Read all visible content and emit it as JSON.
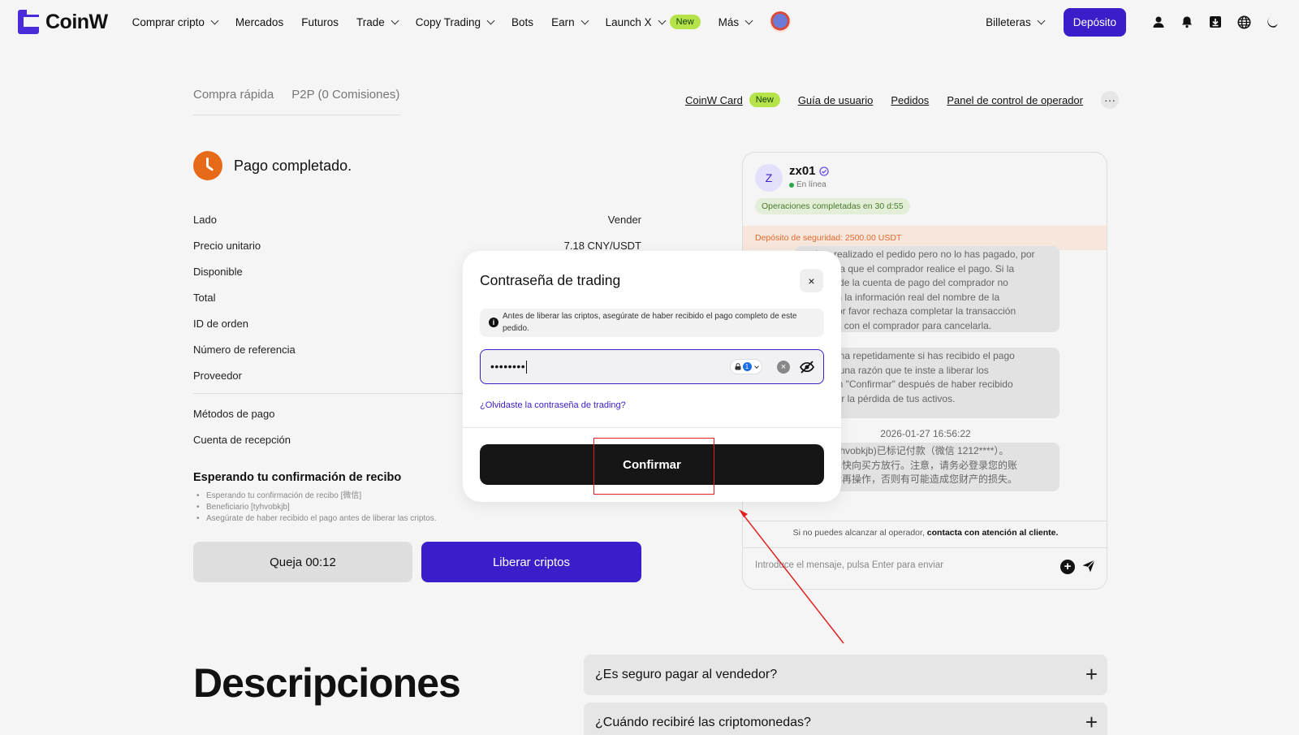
{
  "header": {
    "logo_text": "CoinW",
    "nav": [
      {
        "label": "Comprar cripto",
        "chevron": true
      },
      {
        "label": "Mercados",
        "chevron": false
      },
      {
        "label": "Futuros",
        "chevron": false
      },
      {
        "label": "Trade",
        "chevron": true
      },
      {
        "label": "Copy Trading",
        "chevron": true
      },
      {
        "label": "Bots",
        "chevron": false
      },
      {
        "label": "Earn",
        "chevron": true
      },
      {
        "label": "Launch X",
        "chevron": true,
        "badge": "New"
      },
      {
        "label": "Más",
        "chevron": true
      }
    ],
    "wallets_label": "Billeteras",
    "deposit_label": "Depósito",
    "icons": [
      "user-icon",
      "bell-icon",
      "download-icon",
      "globe-icon",
      "moon-icon"
    ],
    "accent": "#3b1dc9"
  },
  "tabs": {
    "quick_buy": "Compra rápida",
    "p2p": "P2P (0 Comisiones)"
  },
  "toplinks": {
    "card": "CoinW Card",
    "card_badge": "New",
    "guide": "Guía de usuario",
    "orders": "Pedidos",
    "operator_panel": "Panel de control de operador",
    "more": "···"
  },
  "order": {
    "status_title": "Pago completado.",
    "rows": [
      {
        "label": "Lado",
        "value": "Vender"
      },
      {
        "label": "Precio unitario",
        "value": "7.18 CNY/USDT"
      },
      {
        "label": "Disponible",
        "value": ""
      },
      {
        "label": "Total",
        "value": ""
      },
      {
        "label": "ID de orden",
        "value": ""
      },
      {
        "label": "Número de referencia",
        "value": ""
      },
      {
        "label": "Proveedor",
        "value": ""
      },
      {
        "label": "Métodos de pago",
        "value": ""
      },
      {
        "label": "Cuenta de recepción",
        "value": ""
      }
    ],
    "waiting_title": "Esperando tu confirmación de recibo",
    "bullets": [
      "Esperando tu confirmación de recibo [微信]",
      "Beneficiario [tyhvobkjb]",
      "Asegúrate de haber recibido el pago antes de liberar las criptos."
    ],
    "complaint_label": "Queja 00:12",
    "release_label": "Liberar criptos"
  },
  "chat": {
    "avatar_letter": "Z",
    "name": "zx01",
    "status": "En línea",
    "ops": "Operaciones completadas en 30 d:55",
    "deposit": "Depósito de seguridad: 2500.00 USDT",
    "messages": [
      "… has realizado el pedido pero no lo has pagado, por\n…spera a que el comprador realice el pago. Si la\n…ación de la cuenta de pago del comprador no\n…de con la información real del nombre de la\n…ma, por favor rechaza completar la transacción\n…egocia con el comprador para cancelarla.",
      "…confirma repetidamente si has recibido el pago\n…n ninguna razón que te inste a liberar los\n… clic en \"Confirmar\" después de haber recibido\n…a evitar la pérdida de tus activos.",
      "…名：tyhvobkjb)已标记付款（微信 1212****）。\n…收并尽快向买方放行。注意，请务必登录您的账\n…收款后再操作，否则有可能造成您财产的损失。"
    ],
    "timestamp": "2026-01-27 16:56:22",
    "help_prefix": "Si no puedes alcanzar al operador, ",
    "help_link": "contacta con atención al cliente.",
    "input_placeholder": "Introduce el mensaje, pulsa Enter para enviar"
  },
  "descriptions": {
    "title": "Descripciones",
    "faqs": [
      "¿Es seguro pagar al vendedor?",
      "¿Cuándo recibiré las criptomonedas?"
    ]
  },
  "modal": {
    "title": "Contraseña de trading",
    "close": "×",
    "notice": "Antes de liberar las criptos, asegúrate de haber recibido el pago completo de este pedido.",
    "password_value": "••••••••",
    "forgot": "¿Olvidaste la contraseña de trading?",
    "confirm": "Confirmar"
  }
}
